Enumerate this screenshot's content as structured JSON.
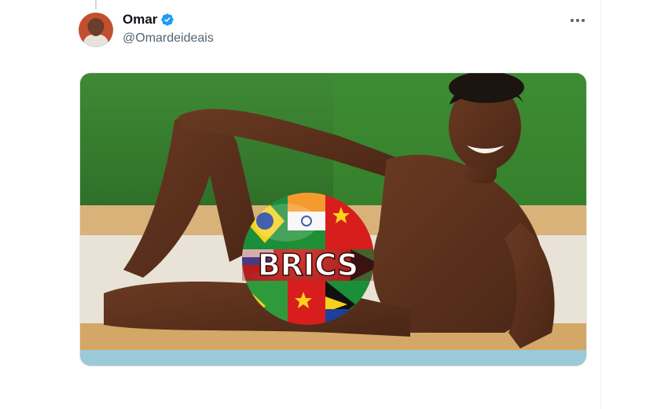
{
  "tweet": {
    "author": {
      "display_name": "Omar",
      "handle": "@Omardeideais",
      "verified": true,
      "avatar_icon": "avatar-photo"
    },
    "more_icon": "more-dots-icon",
    "media": {
      "overlay_text": "BRICS"
    }
  },
  "colors": {
    "verified": "#1d9bf0",
    "name": "#0f1419",
    "secondary": "#536471"
  }
}
